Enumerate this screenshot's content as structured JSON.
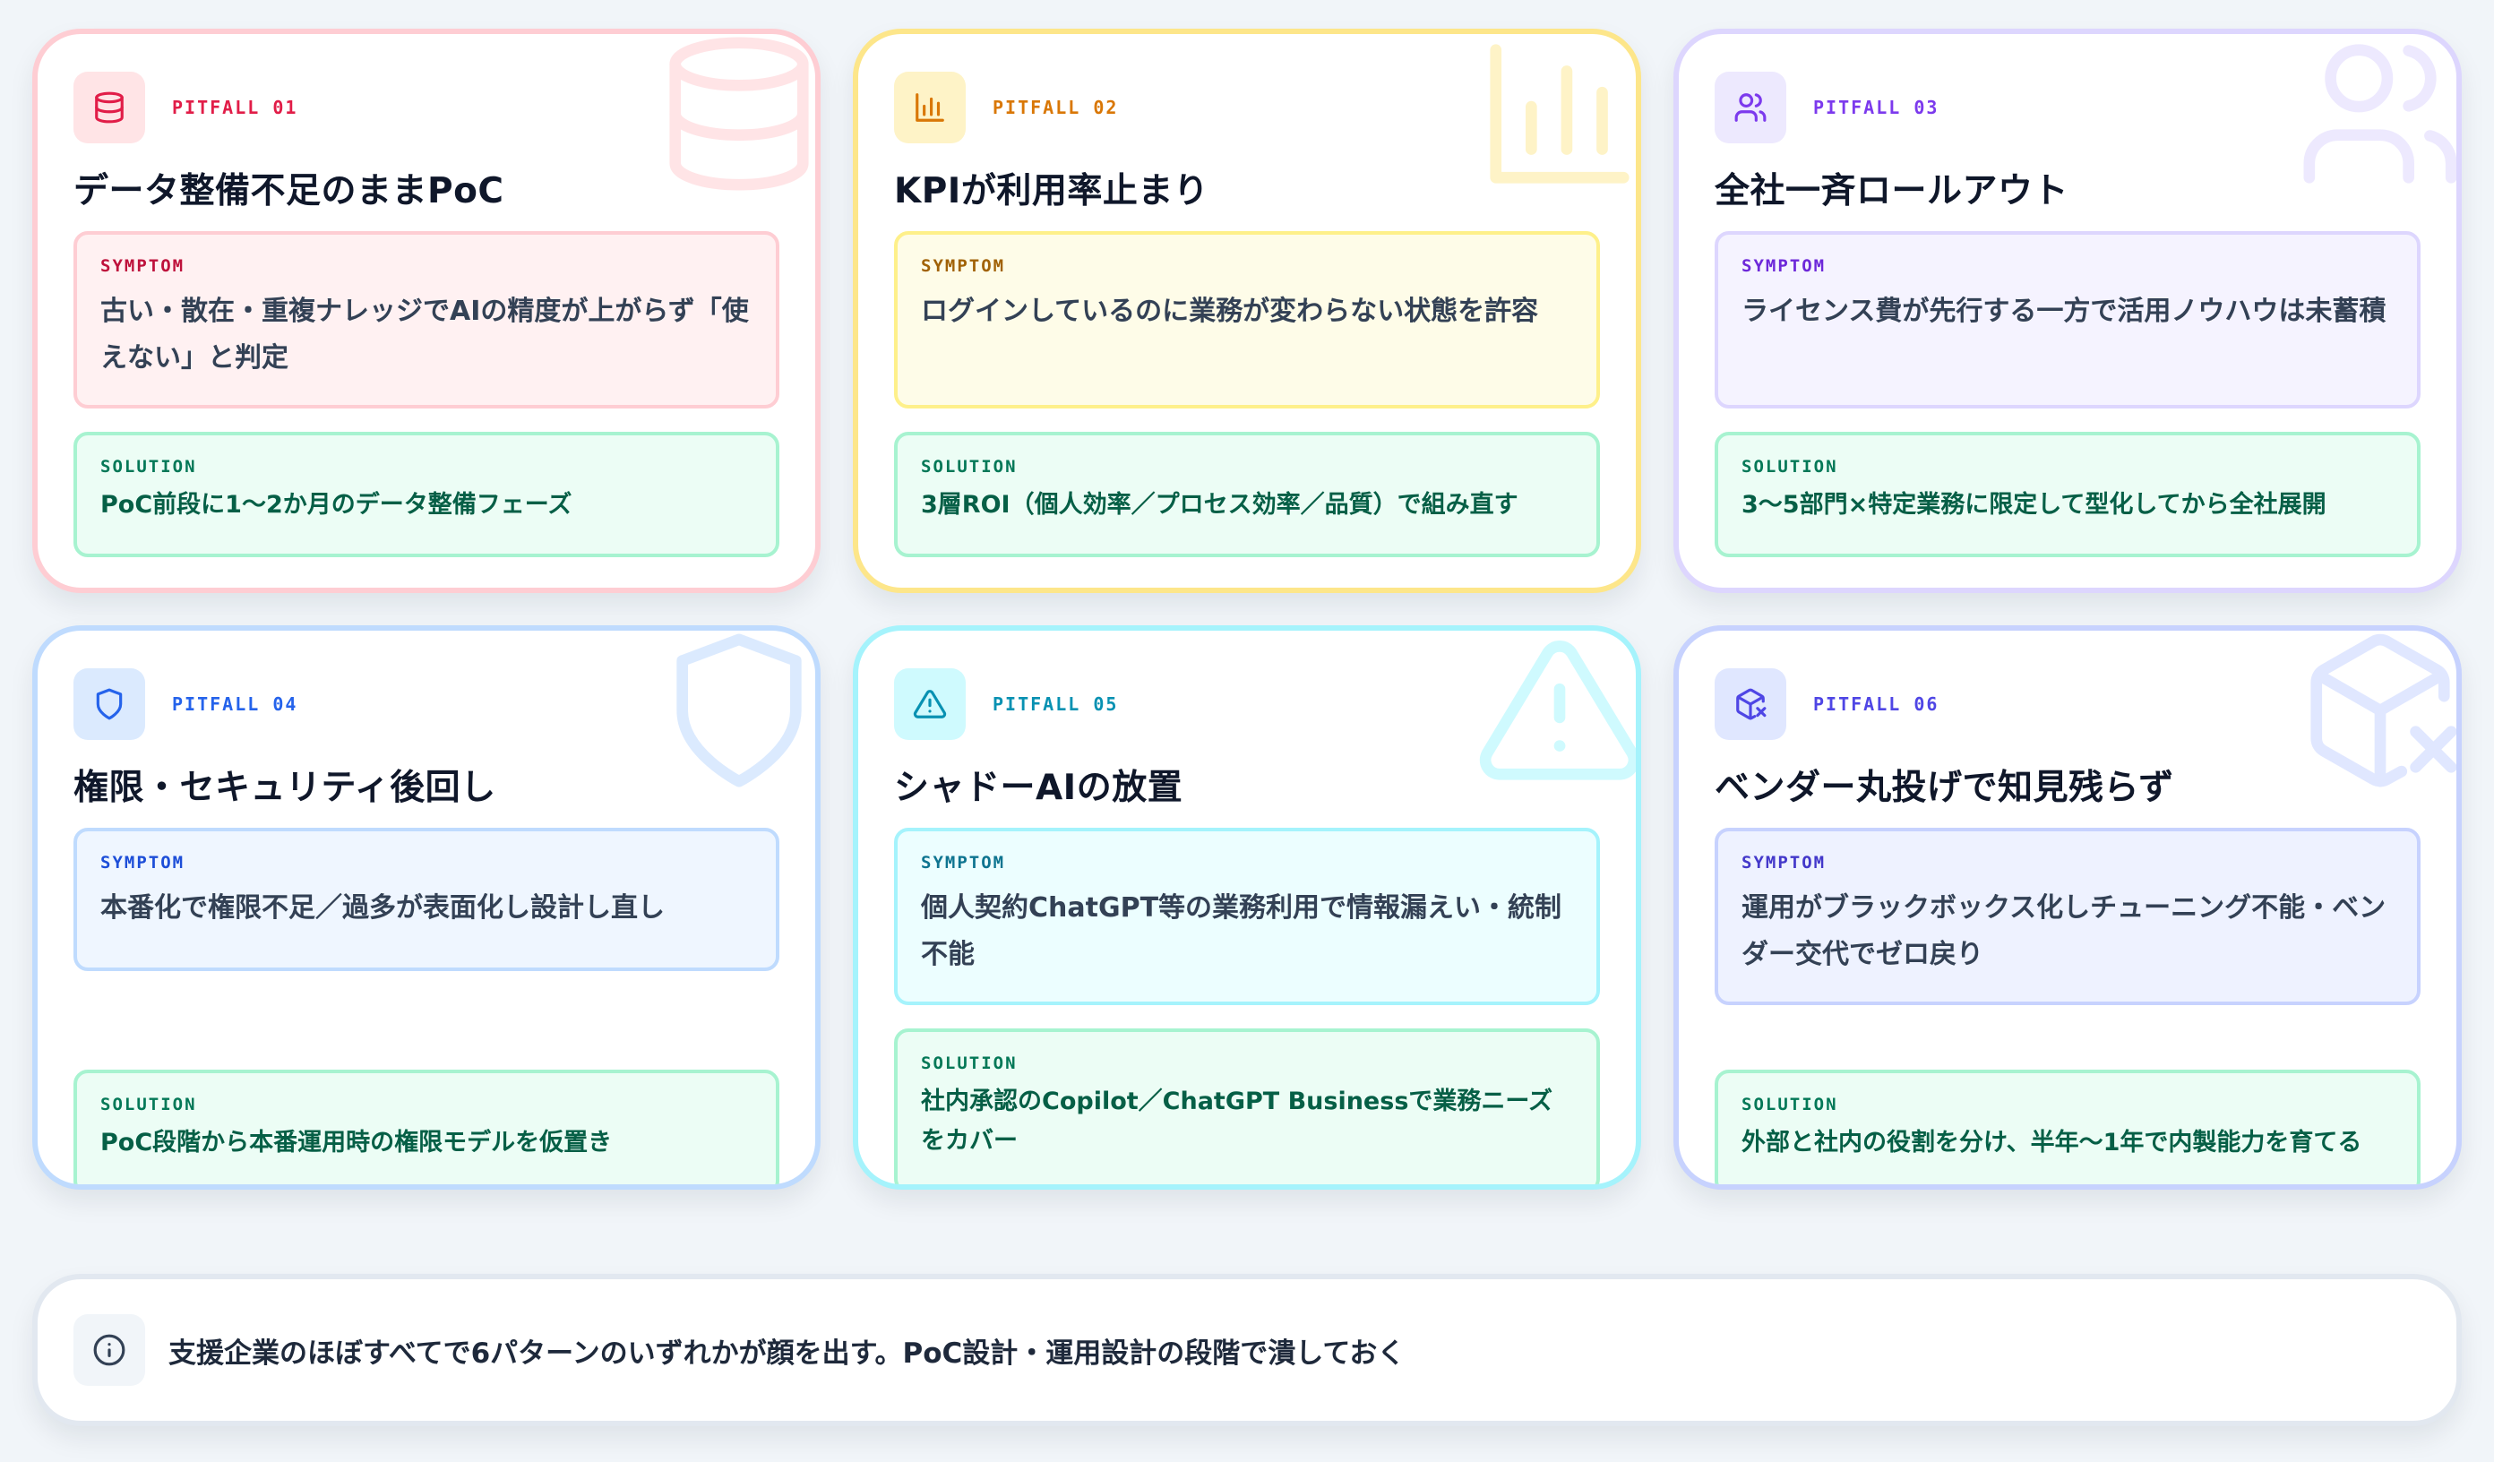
{
  "cards": [
    {
      "label": "PITFALL 01",
      "icon": "database-icon",
      "accent": "#e11d48",
      "title": "データ整備不足のままPoC",
      "symptom_label": "SYMPTOM",
      "symptom": "古い・散在・重複ナレッジでAIの精度が上がらず「使えない」と判定",
      "solution_label": "SOLUTION",
      "solution": "PoC前段に1〜2か月のデータ整備フェーズ"
    },
    {
      "label": "PITFALL 02",
      "icon": "bar-chart-icon",
      "accent": "#d97706",
      "title": "KPIが利用率止まり",
      "symptom_label": "SYMPTOM",
      "symptom": "ログインしているのに業務が変わらない状態を許容",
      "solution_label": "SOLUTION",
      "solution": "3層ROI（個人効率／プロセス効率／品質）で組み直す"
    },
    {
      "label": "PITFALL 03",
      "icon": "users-icon",
      "accent": "#7c3aed",
      "title": "全社一斉ロールアウト",
      "symptom_label": "SYMPTOM",
      "symptom": "ライセンス費が先行する一方で活用ノウハウは未蓄積",
      "solution_label": "SOLUTION",
      "solution": "3〜5部門×特定業務に限定して型化してから全社展開"
    },
    {
      "label": "PITFALL 04",
      "icon": "shield-icon",
      "accent": "#2563eb",
      "title": "権限・セキュリティ後回し",
      "symptom_label": "SYMPTOM",
      "symptom": "本番化で権限不足／過多が表面化し設計し直し",
      "solution_label": "SOLUTION",
      "solution": "PoC段階から本番運用時の権限モデルを仮置き"
    },
    {
      "label": "PITFALL 05",
      "icon": "warning-icon",
      "accent": "#0891b2",
      "title": "シャドーAIの放置",
      "symptom_label": "SYMPTOM",
      "symptom": "個人契約ChatGPT等の業務利用で情報漏えい・統制不能",
      "solution_label": "SOLUTION",
      "solution": "社内承認のCopilot／ChatGPT Businessで業務ニーズをカバー"
    },
    {
      "label": "PITFALL 06",
      "icon": "package-x-icon",
      "accent": "#4f46e5",
      "title": "ベンダー丸投げで知見残らず",
      "symptom_label": "SYMPTOM",
      "symptom": "運用がブラックボックス化しチューニング不能・ベンダー交代でゼロ戻り",
      "solution_label": "SOLUTION",
      "solution": "外部と社内の役割を分け、半年〜1年で内製能力を育てる"
    }
  ],
  "footer": {
    "icon": "info-icon",
    "text": "支援企業のほぼすべてで6パターンのいずれかが顔を出す。PoC設計・運用設計の段階で潰しておく"
  }
}
